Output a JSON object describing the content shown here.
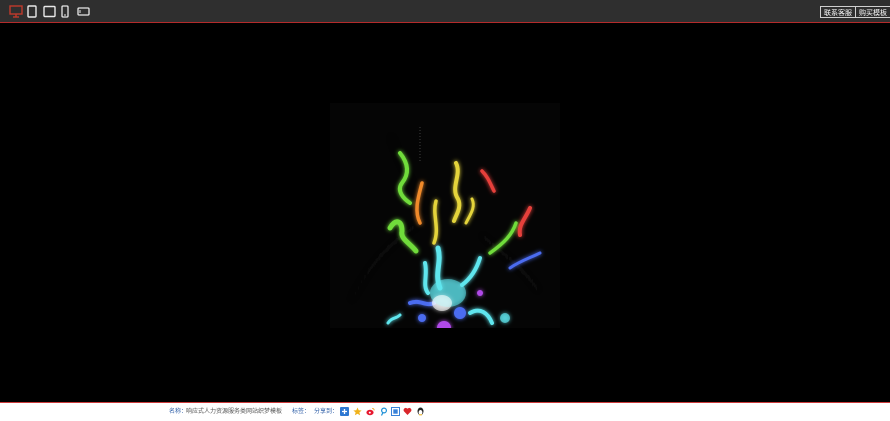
{
  "toolbar": {
    "contact_label": "联系客服",
    "buy_label": "购买模板",
    "devices": [
      "desktop",
      "tablet-portrait",
      "tablet-landscape",
      "phone",
      "phone-landscape"
    ],
    "active_device": "desktop",
    "active_color": "#c0392b"
  },
  "footer": {
    "name_label": "名称：",
    "name_value": "响应式人力资源服务类网站织梦模板",
    "tags_label": "标签：",
    "share_label": "分享到：",
    "share_icons": [
      "plus-icon",
      "qzone-star-icon",
      "weibo-icon",
      "tencent-weibo-icon",
      "qq-space-icon",
      "heart-icon",
      "qq-penguin-icon"
    ]
  },
  "preview": {
    "colors": {
      "red": "#e6403a",
      "orange": "#f08a2a",
      "yellow": "#e4d43a",
      "green": "#6fdc3a",
      "cyan": "#5ee6ee",
      "blue": "#4b6cf0",
      "purple": "#b04ae8"
    }
  }
}
